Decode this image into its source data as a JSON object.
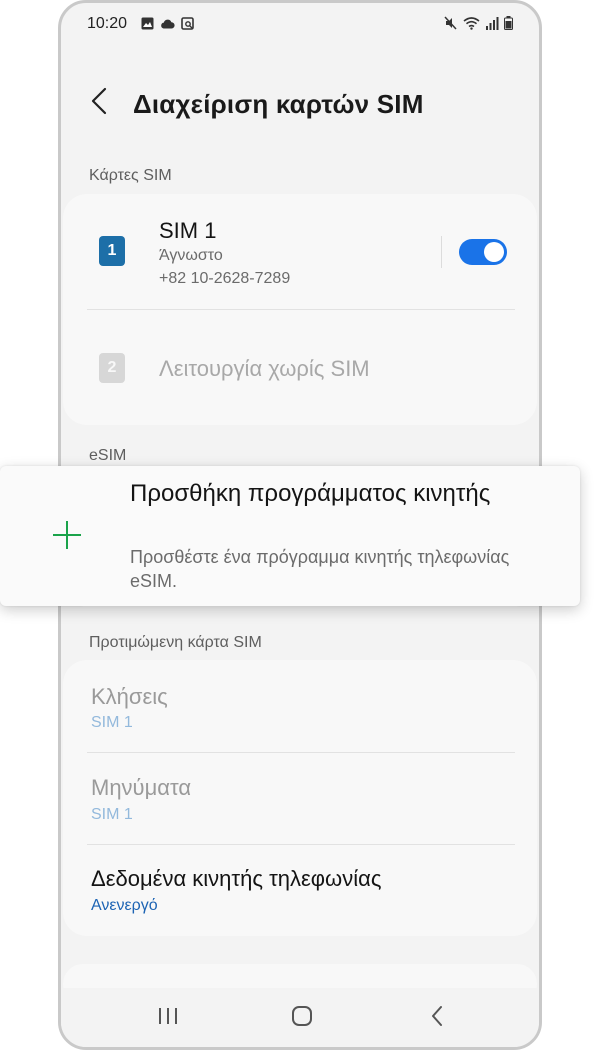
{
  "status_bar": {
    "time": "10:20",
    "left_icons": [
      "gallery-icon",
      "cloud-icon",
      "screenshot-icon"
    ],
    "right_icons": [
      "mute-icon",
      "wifi-icon",
      "signal-icon",
      "battery-icon"
    ]
  },
  "app_bar": {
    "title": "Διαχείριση καρτών SIM",
    "back_icon": "back-arrow-icon"
  },
  "sim_cards": {
    "header": "Κάρτες SIM",
    "sim1": {
      "badge": "1",
      "name": "SIM 1",
      "status": "Άγνωστο",
      "number": "+82 10-2628-7289",
      "enabled": true
    },
    "sim2": {
      "badge": "2",
      "label": "Λειτουργία χωρίς SIM"
    }
  },
  "esim": {
    "header": "eSIM",
    "add_plan": {
      "icon": "plus-icon",
      "title": "Προσθήκη προγράμματος κινητής",
      "subtitle": "Προσθέστε ένα πρόγραμμα κινητής τηλεφωνίας eSIM."
    }
  },
  "preferred": {
    "header": "Προτιμώμενη κάρτα SIM",
    "calls": {
      "title": "Κλήσεις",
      "value": "SIM 1"
    },
    "messages": {
      "title": "Μηνύματα",
      "value": "SIM 1"
    },
    "mobile_data": {
      "title": "Δεδομένα κινητής τηλεφωνίας",
      "value": "Ανενεργό"
    }
  },
  "nav_bar": {
    "buttons": [
      "recents-icon",
      "home-icon",
      "back-icon"
    ]
  },
  "colors": {
    "accent": "#1a73e8",
    "sim1_badge": "#1d6fa8",
    "plus_icon": "#1aa34a",
    "link_value": "#1d64b4"
  }
}
